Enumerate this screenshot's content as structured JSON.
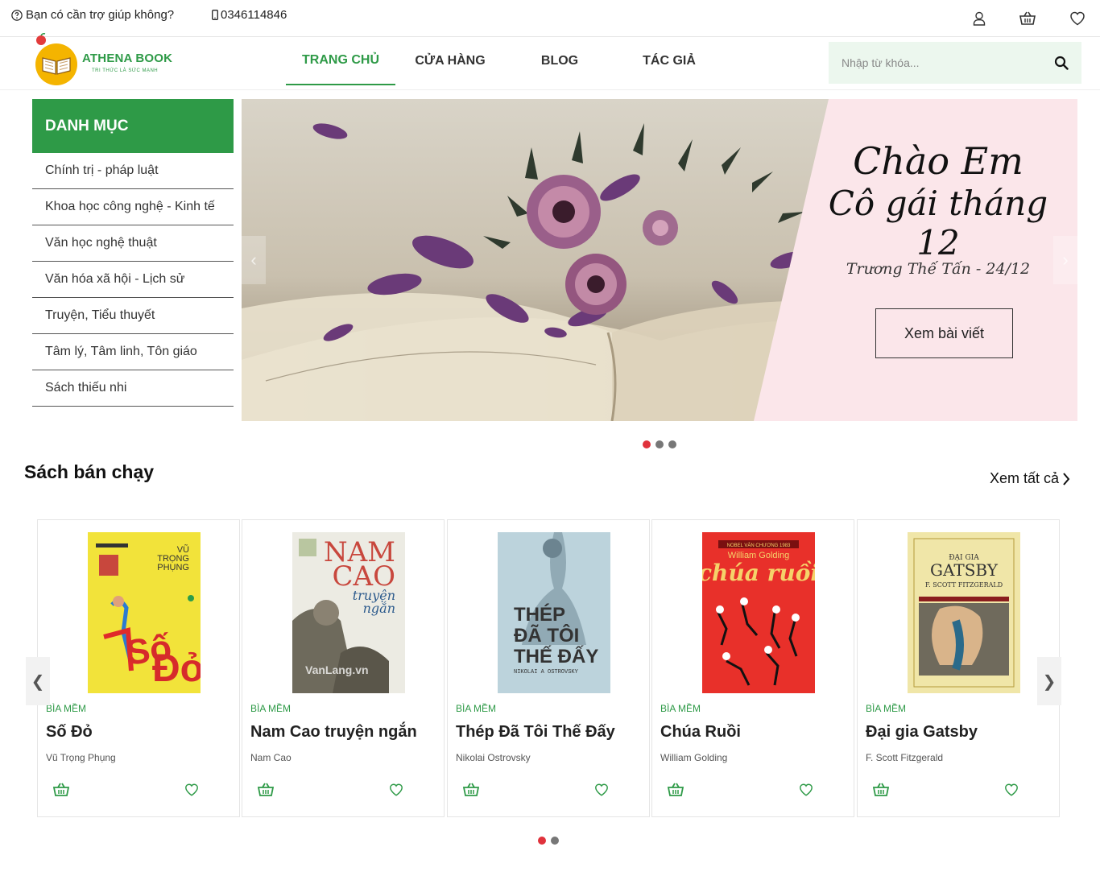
{
  "topbar": {
    "help_text": "Bạn có cần trợ giúp không?",
    "phone": "0346114846",
    "icons": [
      "user-icon",
      "cart-icon",
      "heart-icon"
    ]
  },
  "header": {
    "logo_text": "ATHENA BOOK",
    "logo_tagline": "TRI THỨC LÀ SỨC MẠNH",
    "nav": [
      {
        "label": "TRANG CHỦ",
        "active": true
      },
      {
        "label": "CỬA HÀNG",
        "active": false
      },
      {
        "label": "BLOG",
        "active": false
      },
      {
        "label": "TÁC GIẢ",
        "active": false
      }
    ],
    "search_placeholder": "Nhập từ khóa..."
  },
  "categories": {
    "title": "DANH MỤC",
    "items": [
      "Chính trị - pháp luật",
      "Khoa học công nghệ - Kinh tế",
      "Văn học nghệ thuật",
      "Văn hóa xã hội - Lịch sử",
      "Truyện, Tiểu thuyết",
      "Tâm lý, Tâm linh, Tôn giáo",
      "Sách thiếu nhi"
    ]
  },
  "banner": {
    "title_line1": "Chào Em",
    "title_line2": "Cô gái tháng 12",
    "subtitle": "Trương Thế Tấn - 24/12",
    "button": "Xem bài viết",
    "slides": 3,
    "active_slide": 1
  },
  "bestsellers": {
    "title": "Sách bán chạy",
    "view_all": "Xem tất cả",
    "pages": 2,
    "active_page": 1,
    "products": [
      {
        "type": "BÌA MỀM",
        "title": "Số Đỏ",
        "author": "Vũ Trọng Phụng",
        "cover_color": "#f2e33a"
      },
      {
        "type": "BÌA MỀM",
        "title": "Nam Cao truyện ngắn",
        "author": "Nam Cao",
        "cover_color": "#ecebe3"
      },
      {
        "type": "BÌA MỀM",
        "title": "Thép Đã Tôi Thế Đấy",
        "author": "Nikolai Ostrovsky",
        "cover_color": "#bcd3dc"
      },
      {
        "type": "BÌA MỀM",
        "title": "Chúa Ruồi",
        "author": "William Golding",
        "cover_color": "#e8302a"
      },
      {
        "type": "BÌA MỀM",
        "title": "Đại gia Gatsby",
        "author": "F. Scott Fitzgerald",
        "cover_color": "#f0e6a8"
      }
    ]
  },
  "colors": {
    "brand_green": "#2e9a47",
    "active_dot": "#e0323c",
    "search_bg": "#ecf7ee",
    "banner_pink": "#fbe6ea"
  }
}
